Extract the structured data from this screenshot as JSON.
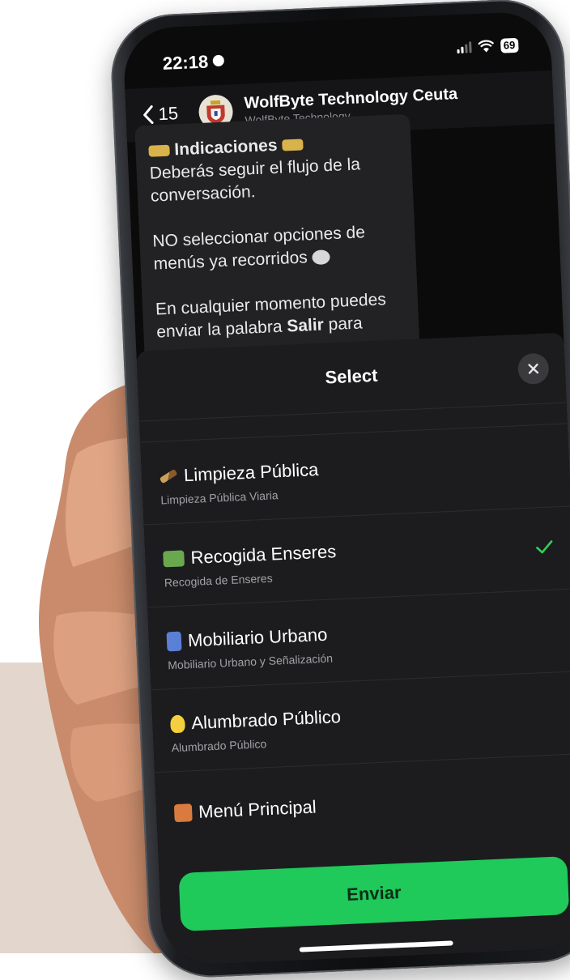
{
  "colors": {
    "background_band": "#e2d6cd",
    "accent_green": "#1fc95a",
    "sheet_bg": "#1c1c1e"
  },
  "status_bar": {
    "time": "22:18",
    "battery": "69"
  },
  "chat_header": {
    "back_count": "15",
    "title": "WolfByte Technology Ceuta",
    "subtitle": "WolfByte Technology"
  },
  "message": {
    "heading": "Indicaciones",
    "line1": "Deberás seguir el flujo de la conversación.",
    "line2": "NO seleccionar opciones de menús ya recorridos",
    "line3_prefix": "En cualquier momento puedes enviar la palabra ",
    "line3_bold": "Salir",
    "line3_suffix": " para"
  },
  "sheet": {
    "title": "Select",
    "options": [
      {
        "label": "Limpieza Pública",
        "sub": "Limpieza Pública Viaria",
        "icon": "broom-icon",
        "selected": false
      },
      {
        "label": "Recogida Enseres",
        "sub": "Recogida de Enseres",
        "icon": "truck-icon",
        "selected": true
      },
      {
        "label": "Mobiliario Urbano",
        "sub": "Mobiliario Urbano y Señalización",
        "icon": "playground-slide-icon",
        "selected": false
      },
      {
        "label": "Alumbrado Público",
        "sub": "Alumbrado Público",
        "icon": "light-bulb-icon",
        "selected": false
      },
      {
        "label": "Menú Principal",
        "sub": "",
        "icon": "house-icon",
        "selected": false
      }
    ],
    "send_label": "Enviar"
  }
}
